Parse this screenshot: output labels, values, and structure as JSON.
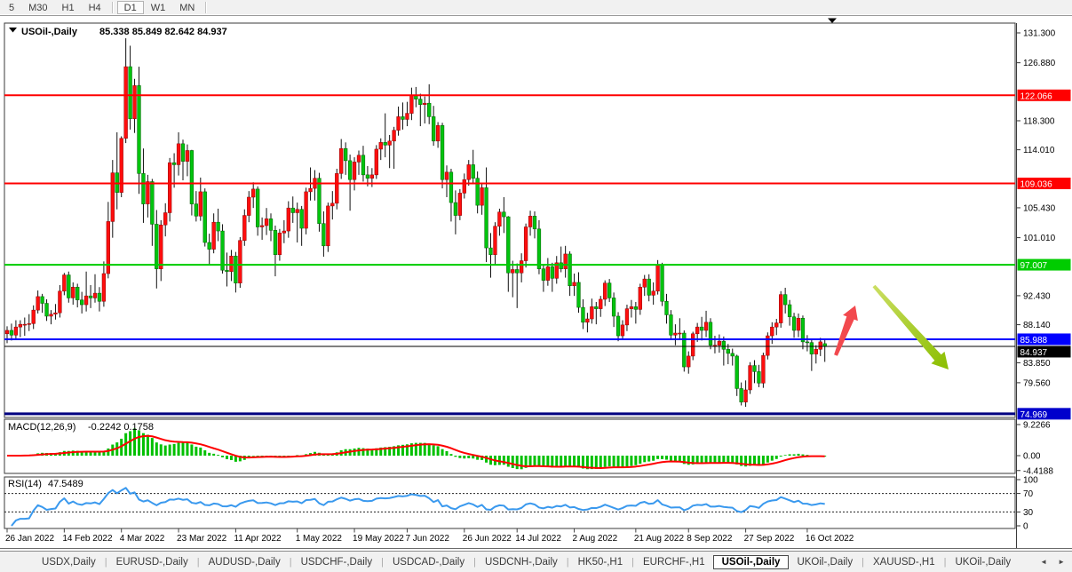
{
  "toolbar": {
    "timeframes": [
      "5",
      "M30",
      "H1",
      "H4",
      "D1",
      "W1",
      "MN"
    ],
    "active": "D1"
  },
  "chart_data": {
    "type": "candlestick",
    "title_text": "USOil-,Daily",
    "ohlc_text": "85.338 85.849 82.642 84.937",
    "last_candle": {
      "open": 85.338,
      "high": 85.849,
      "low": 82.642,
      "close": 84.937
    },
    "up_color": "#ff0e0e",
    "down_color": "#00c40e",
    "y_axis_ticks": [
      {
        "v": 131.3,
        "t": "131.300"
      },
      {
        "v": 126.88,
        "t": "126.880"
      },
      {
        "v": 118.3,
        "t": "118.300"
      },
      {
        "v": 114.01,
        "t": "114.010"
      },
      {
        "v": 105.43,
        "t": "105.430"
      },
      {
        "v": 101.01,
        "t": "101.010"
      },
      {
        "v": 92.43,
        "t": "92.430"
      },
      {
        "v": 88.14,
        "t": "88.140"
      },
      {
        "v": 83.85,
        "t": "83.850"
      },
      {
        "v": 79.56,
        "t": "79.560"
      }
    ],
    "levels": [
      {
        "v": 122.066,
        "t": "122.066",
        "color": "#ff0000",
        "width": 2
      },
      {
        "v": 109.036,
        "t": "109.036",
        "color": "#ff0000",
        "width": 2
      },
      {
        "v": 97.007,
        "t": "97.007",
        "color": "#00cc00",
        "width": 2
      },
      {
        "v": 85.988,
        "t": "85.988",
        "color": "#0000ff",
        "width": 2
      },
      {
        "v": 84.937,
        "t": "84.937",
        "color": "#000000",
        "width": 1
      },
      {
        "v": 74.969,
        "t": "74.969",
        "color": "#000080",
        "width": 3,
        "badge": "#0000cc"
      }
    ],
    "x_labels": [
      {
        "t": "26 Jan 2022",
        "i": 0
      },
      {
        "t": "14 Feb 2022",
        "i": 13
      },
      {
        "t": "4 Mar 2022",
        "i": 26
      },
      {
        "t": "23 Mar 2022",
        "i": 39
      },
      {
        "t": "11 Apr 2022",
        "i": 52
      },
      {
        "t": "1 May 2022",
        "i": 66
      },
      {
        "t": "19 May 2022",
        "i": 79
      },
      {
        "t": "7 Jun 2022",
        "i": 91
      },
      {
        "t": "26 Jun 2022",
        "i": 104
      },
      {
        "t": "14 Jul 2022",
        "i": 116
      },
      {
        "t": "2 Aug 2022",
        "i": 129
      },
      {
        "t": "21 Aug 2022",
        "i": 143
      },
      {
        "t": "8 Sep 2022",
        "i": 155
      },
      {
        "t": "27 Sep 2022",
        "i": 168
      },
      {
        "t": "16 Oct 2022",
        "i": 182
      }
    ],
    "candles": [
      [
        86.8,
        87.9,
        85.4,
        87.3
      ],
      [
        87.3,
        88.3,
        85.8,
        86.6
      ],
      [
        86.6,
        88.8,
        86.0,
        87.8
      ],
      [
        87.8,
        88.8,
        86.3,
        88.2
      ],
      [
        88.2,
        89.2,
        86.5,
        88.2
      ],
      [
        88.2,
        89.7,
        87.2,
        88.3
      ],
      [
        88.3,
        91.0,
        87.5,
        90.3
      ],
      [
        90.3,
        93.2,
        89.8,
        92.3
      ],
      [
        92.3,
        92.7,
        89.9,
        91.3
      ],
      [
        91.3,
        91.9,
        88.7,
        89.4
      ],
      [
        89.4,
        90.3,
        88.2,
        89.7
      ],
      [
        89.7,
        91.2,
        88.9,
        89.9
      ],
      [
        89.9,
        94.0,
        89.2,
        93.1
      ],
      [
        93.1,
        95.8,
        92.5,
        95.5
      ],
      [
        95.5,
        96.0,
        91.4,
        92.1
      ],
      [
        92.1,
        94.4,
        91.1,
        93.7
      ],
      [
        93.7,
        94.2,
        90.7,
        91.8
      ],
      [
        91.8,
        93.0,
        89.8,
        91.1
      ],
      [
        91.1,
        96.0,
        90.1,
        92.4
      ],
      [
        92.4,
        94.0,
        90.6,
        92.1
      ],
      [
        92.1,
        95.6,
        91.4,
        92.8
      ],
      [
        92.8,
        93.7,
        90.1,
        91.6
      ],
      [
        91.6,
        97.5,
        90.8,
        95.7
      ],
      [
        95.7,
        106.3,
        95.0,
        103.4
      ],
      [
        103.4,
        112.5,
        101.0,
        110.6
      ],
      [
        110.6,
        116.6,
        105.2,
        107.7
      ],
      [
        107.7,
        116.0,
        107.0,
        115.7
      ],
      [
        115.7,
        130.5,
        115.0,
        126.3
      ],
      [
        126.3,
        129.4,
        117.0,
        118.6
      ],
      [
        118.6,
        124.5,
        116.5,
        123.5
      ],
      [
        123.5,
        126.3,
        107.5,
        110.5
      ],
      [
        110.5,
        114.2,
        103.2,
        106.0
      ],
      [
        106.0,
        110.3,
        104.0,
        109.3
      ],
      [
        109.3,
        109.7,
        99.8,
        103.0
      ],
      [
        103.0,
        105.1,
        93.5,
        96.4
      ],
      [
        96.4,
        103.6,
        94.6,
        102.9
      ],
      [
        102.9,
        106.1,
        101.2,
        104.7
      ],
      [
        104.7,
        112.8,
        103.4,
        112.1
      ],
      [
        112.1,
        113.5,
        108.4,
        111.8
      ],
      [
        111.8,
        116.6,
        110.2,
        114.9
      ],
      [
        114.9,
        115.5,
        109.5,
        112.3
      ],
      [
        112.3,
        114.8,
        110.1,
        113.9
      ],
      [
        113.9,
        114.0,
        104.3,
        106.0
      ],
      [
        106.0,
        107.9,
        103.4,
        104.2
      ],
      [
        104.2,
        109.9,
        103.5,
        107.8
      ],
      [
        107.8,
        108.3,
        99.7,
        100.3
      ],
      [
        100.3,
        101.6,
        97.0,
        99.3
      ],
      [
        99.3,
        104.6,
        98.7,
        103.3
      ],
      [
        103.3,
        105.3,
        100.5,
        102.0
      ],
      [
        102.0,
        103.0,
        95.7,
        96.2
      ],
      [
        96.2,
        98.8,
        93.8,
        96.0
      ],
      [
        96.0,
        99.2,
        94.6,
        98.3
      ],
      [
        98.3,
        98.9,
        92.9,
        94.3
      ],
      [
        94.3,
        101.1,
        93.6,
        100.6
      ],
      [
        100.6,
        105.2,
        99.8,
        104.3
      ],
      [
        104.3,
        107.9,
        103.3,
        107.0
      ],
      [
        107.0,
        109.2,
        105.4,
        108.2
      ],
      [
        108.2,
        108.6,
        101.3,
        102.6
      ],
      [
        102.6,
        104.0,
        100.7,
        102.8
      ],
      [
        102.8,
        105.4,
        101.4,
        103.8
      ],
      [
        103.8,
        104.6,
        100.5,
        102.1
      ],
      [
        102.1,
        102.8,
        95.3,
        98.5
      ],
      [
        98.5,
        102.3,
        97.6,
        101.7
      ],
      [
        101.7,
        103.6,
        100.2,
        102.0
      ],
      [
        102.0,
        106.4,
        101.0,
        105.4
      ],
      [
        105.4,
        107.1,
        103.2,
        104.7
      ],
      [
        104.7,
        106.2,
        100.3,
        105.2
      ],
      [
        105.2,
        105.7,
        99.8,
        102.4
      ],
      [
        102.4,
        108.4,
        101.5,
        107.8
      ],
      [
        107.8,
        111.4,
        106.5,
        108.3
      ],
      [
        108.3,
        111.0,
        106.5,
        109.8
      ],
      [
        109.8,
        110.6,
        101.9,
        103.1
      ],
      [
        103.1,
        104.9,
        98.2,
        99.8
      ],
      [
        99.8,
        106.2,
        98.9,
        105.7
      ],
      [
        105.7,
        107.9,
        103.7,
        106.1
      ],
      [
        106.1,
        111.2,
        105.2,
        110.5
      ],
      [
        110.5,
        115.6,
        109.7,
        114.2
      ],
      [
        114.2,
        115.1,
        110.3,
        112.4
      ],
      [
        112.4,
        113.3,
        105.0,
        109.6
      ],
      [
        109.6,
        112.9,
        108.0,
        112.2
      ],
      [
        112.2,
        113.9,
        110.3,
        113.2
      ],
      [
        113.2,
        114.6,
        109.3,
        110.3
      ],
      [
        110.3,
        111.6,
        108.6,
        109.8
      ],
      [
        109.8,
        111.3,
        108.5,
        110.3
      ],
      [
        110.3,
        114.7,
        109.7,
        114.1
      ],
      [
        114.1,
        115.7,
        112.5,
        115.1
      ],
      [
        115.1,
        119.4,
        112.9,
        114.7
      ],
      [
        114.7,
        116.2,
        111.3,
        115.3
      ],
      [
        115.3,
        117.4,
        111.2,
        116.9
      ],
      [
        116.9,
        120.4,
        116.1,
        118.9
      ],
      [
        118.9,
        121.0,
        117.0,
        118.5
      ],
      [
        118.5,
        121.1,
        117.5,
        119.4
      ],
      [
        119.4,
        123.2,
        118.4,
        122.1
      ],
      [
        122.1,
        123.3,
        120.3,
        121.5
      ],
      [
        121.5,
        122.3,
        117.5,
        120.7
      ],
      [
        120.7,
        121.9,
        117.9,
        120.9
      ],
      [
        120.9,
        123.7,
        117.8,
        118.9
      ],
      [
        118.9,
        120.5,
        114.6,
        115.3
      ],
      [
        115.3,
        118.1,
        114.3,
        117.6
      ],
      [
        117.6,
        118.0,
        108.3,
        109.6
      ],
      [
        109.6,
        111.7,
        107.0,
        110.7
      ],
      [
        110.7,
        111.2,
        103.4,
        106.2
      ],
      [
        106.2,
        108.0,
        101.5,
        104.3
      ],
      [
        104.3,
        108.2,
        103.6,
        107.6
      ],
      [
        107.6,
        110.5,
        106.8,
        109.6
      ],
      [
        109.6,
        112.5,
        108.7,
        111.8
      ],
      [
        111.8,
        114.0,
        108.9,
        109.8
      ],
      [
        109.8,
        110.8,
        104.6,
        105.8
      ],
      [
        105.8,
        109.0,
        104.4,
        108.4
      ],
      [
        108.4,
        111.4,
        97.4,
        99.5
      ],
      [
        99.5,
        101.7,
        95.1,
        98.5
      ],
      [
        98.5,
        103.3,
        96.9,
        102.7
      ],
      [
        102.7,
        105.3,
        101.3,
        104.8
      ],
      [
        104.8,
        107.0,
        101.7,
        104.1
      ],
      [
        104.1,
        104.2,
        93.0,
        95.8
      ],
      [
        95.8,
        97.6,
        92.2,
        96.3
      ],
      [
        96.3,
        97.2,
        90.6,
        95.8
      ],
      [
        95.8,
        98.7,
        94.4,
        97.6
      ],
      [
        97.6,
        103.1,
        96.6,
        102.6
      ],
      [
        102.6,
        105.0,
        101.3,
        104.2
      ],
      [
        104.2,
        104.9,
        100.9,
        102.3
      ],
      [
        102.3,
        103.6,
        95.6,
        96.4
      ],
      [
        96.4,
        97.1,
        93.0,
        94.7
      ],
      [
        94.7,
        98.0,
        93.9,
        96.7
      ],
      [
        96.7,
        97.3,
        93.0,
        95.0
      ],
      [
        95.0,
        98.3,
        94.2,
        97.3
      ],
      [
        97.3,
        99.7,
        95.9,
        96.4
      ],
      [
        96.4,
        99.8,
        95.1,
        98.6
      ],
      [
        98.6,
        99.0,
        92.4,
        93.9
      ],
      [
        93.9,
        95.7,
        92.4,
        94.4
      ],
      [
        94.4,
        95.9,
        89.9,
        90.7
      ],
      [
        90.7,
        91.9,
        87.5,
        88.5
      ],
      [
        88.5,
        89.9,
        87.0,
        89.0
      ],
      [
        89.0,
        92.0,
        88.3,
        90.8
      ],
      [
        90.8,
        91.5,
        88.2,
        90.5
      ],
      [
        90.5,
        92.4,
        89.3,
        91.9
      ],
      [
        91.9,
        94.7,
        90.9,
        94.3
      ],
      [
        94.3,
        94.9,
        91.5,
        92.1
      ],
      [
        92.1,
        92.9,
        87.8,
        89.4
      ],
      [
        89.4,
        90.0,
        85.7,
        86.5
      ],
      [
        86.5,
        88.8,
        85.9,
        88.1
      ],
      [
        88.1,
        91.1,
        87.2,
        90.5
      ],
      [
        90.5,
        91.8,
        89.2,
        90.8
      ],
      [
        90.8,
        91.5,
        88.3,
        90.4
      ],
      [
        90.4,
        94.2,
        89.6,
        93.7
      ],
      [
        93.7,
        95.5,
        92.4,
        94.9
      ],
      [
        94.9,
        95.6,
        91.6,
        92.5
      ],
      [
        92.5,
        94.4,
        91.1,
        93.1
      ],
      [
        93.1,
        97.7,
        92.6,
        97.0
      ],
      [
        97.0,
        97.3,
        90.9,
        91.6
      ],
      [
        91.6,
        92.7,
        88.3,
        89.6
      ],
      [
        89.6,
        90.3,
        86.0,
        86.6
      ],
      [
        86.6,
        88.2,
        85.1,
        86.9
      ],
      [
        86.9,
        89.1,
        85.9,
        86.9
      ],
      [
        86.9,
        87.3,
        81.2,
        81.9
      ],
      [
        81.9,
        84.2,
        80.9,
        83.5
      ],
      [
        83.5,
        87.1,
        82.9,
        86.8
      ],
      [
        86.8,
        88.4,
        85.6,
        87.8
      ],
      [
        87.8,
        89.3,
        85.8,
        87.3
      ],
      [
        87.3,
        90.2,
        86.3,
        88.5
      ],
      [
        88.5,
        89.1,
        84.5,
        85.1
      ],
      [
        85.1,
        86.5,
        83.9,
        85.1
      ],
      [
        85.1,
        86.7,
        84.0,
        85.7
      ],
      [
        85.7,
        86.4,
        82.1,
        84.5
      ],
      [
        84.5,
        85.3,
        82.3,
        83.9
      ],
      [
        83.9,
        84.6,
        82.1,
        83.5
      ],
      [
        83.5,
        83.7,
        77.6,
        78.7
      ],
      [
        78.7,
        79.6,
        76.2,
        76.7
      ],
      [
        76.7,
        79.9,
        76.0,
        78.5
      ],
      [
        78.5,
        82.6,
        77.9,
        82.1
      ],
      [
        82.1,
        82.9,
        79.5,
        81.2
      ],
      [
        81.2,
        82.2,
        78.9,
        79.5
      ],
      [
        79.5,
        84.0,
        78.8,
        83.6
      ],
      [
        83.6,
        87.0,
        83.0,
        86.5
      ],
      [
        86.5,
        88.5,
        85.3,
        87.8
      ],
      [
        87.8,
        89.0,
        86.6,
        88.4
      ],
      [
        88.4,
        93.1,
        87.7,
        92.6
      ],
      [
        92.6,
        93.6,
        89.8,
        91.1
      ],
      [
        91.1,
        91.8,
        88.0,
        89.3
      ],
      [
        89.3,
        89.9,
        86.2,
        87.3
      ],
      [
        87.3,
        89.8,
        86.3,
        89.1
      ],
      [
        89.1,
        89.5,
        84.5,
        85.6
      ],
      [
        85.6,
        86.6,
        84.2,
        85.5
      ],
      [
        85.5,
        86.0,
        81.3,
        83.8
      ],
      [
        83.8,
        85.1,
        82.4,
        84.5
      ],
      [
        84.5,
        86.2,
        83.5,
        85.6
      ],
      [
        85.338,
        85.849,
        82.642,
        84.937
      ]
    ],
    "annotations": {
      "arrows": [
        {
          "name": "bullish-arrow",
          "color": "#f2494e",
          "from": [
            941,
            400
          ],
          "to": [
            963,
            344
          ]
        },
        {
          "name": "bearish-arrow",
          "color_from": "#cbde62",
          "color_to": "#8abe00",
          "from": [
            984,
            322
          ],
          "to": [
            1068,
            416
          ]
        }
      ]
    },
    "indicators": {
      "macd": {
        "label": "MACD(12,26,9)",
        "current": "-0.2242 0.1758",
        "params": [
          12,
          26,
          9
        ],
        "hist_color": "#00c000",
        "signal_color": "#ff0000",
        "axis": [
          {
            "v": 9.2266,
            "t": "9.2266"
          },
          {
            "v": 0,
            "t": "0.00"
          },
          {
            "v": -4.4188,
            "t": "-4.4188"
          }
        ]
      },
      "rsi": {
        "label": "RSI(14)",
        "current": "47.5489",
        "period": 14,
        "color": "#3a99ee",
        "levels": [
          70,
          30
        ],
        "axis": [
          {
            "v": 100,
            "t": "100"
          },
          {
            "v": 70,
            "t": "70"
          },
          {
            "v": 30,
            "t": "30"
          },
          {
            "v": 0,
            "t": "0"
          }
        ]
      }
    }
  },
  "tabs": {
    "items": [
      "USDX,Daily",
      "EURUSD-,Daily",
      "AUDUSD-,Daily",
      "USDCHF-,Daily",
      "USDCAD-,Daily",
      "USDCNH-,Daily",
      "HK50-,H1",
      "EURCHF-,H1",
      "USOil-,Daily",
      "UKOil-,Daily",
      "XAUUSD-,H1",
      "UKOil-,Daily"
    ],
    "active_index": 8,
    "nav_left": "◄",
    "nav_right": "►"
  }
}
